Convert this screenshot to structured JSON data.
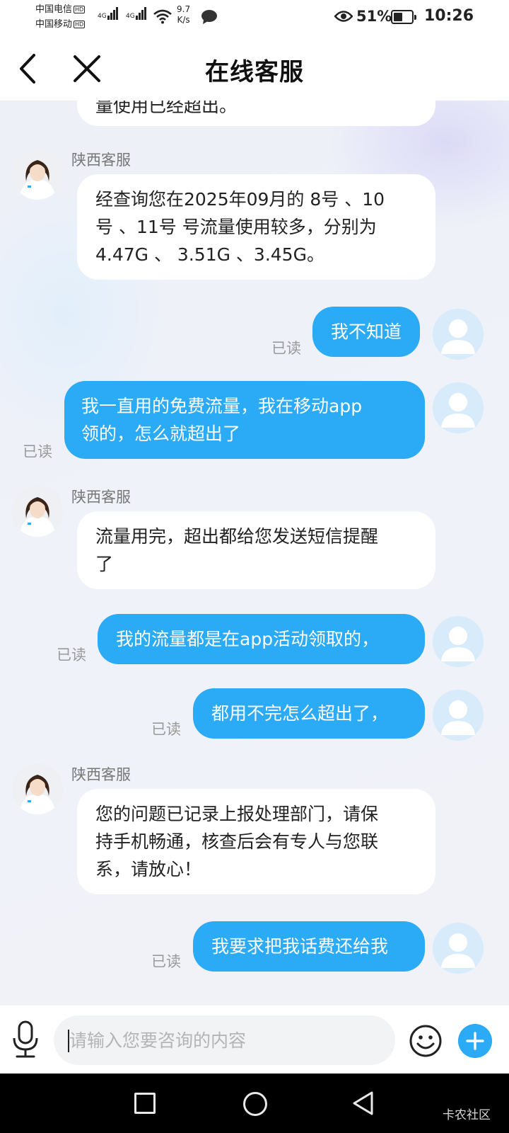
{
  "status_bar": {
    "carrier1": "中国电信",
    "carrier2": "中国移动",
    "hd_badge": "HD",
    "net_type1": "4G",
    "net_type2": "4G",
    "net_speed_value": "9.7",
    "net_speed_unit": "K/s",
    "battery_percent": "51%",
    "battery_level": 0.51,
    "time": "10:26",
    "icons": [
      "signal-icon",
      "wifi-icon",
      "message-icon",
      "eye-icon",
      "battery-icon"
    ]
  },
  "header": {
    "back_icon": "chevron-left-icon",
    "close_icon": "close-icon",
    "title": "在线客服"
  },
  "messages": [
    {
      "role": "agent",
      "partial": true,
      "lines": [
        "量使用已经超出。"
      ]
    },
    {
      "role": "agent",
      "sender": "陕西客服",
      "lines": [
        "经查询您在2025年09月的 8号 、10",
        "号 、11号 号流量使用较多，分别为",
        "4.47G 、 3.51G 、3.45G。"
      ]
    },
    {
      "role": "user",
      "status": "已读",
      "lines": [
        "我不知道"
      ]
    },
    {
      "role": "user",
      "status": "已读",
      "lines": [
        "我一直用的免费流量，我在移动app",
        "领的，怎么就超出了"
      ]
    },
    {
      "role": "agent",
      "sender": "陕西客服",
      "lines": [
        "流量用完，超出都给您发送短信提醒",
        "了"
      ]
    },
    {
      "role": "user",
      "status": "已读",
      "lines": [
        "我的流量都是在app活动领取的，"
      ]
    },
    {
      "role": "user",
      "status": "已读",
      "lines": [
        "都用不完怎么超出了，"
      ]
    },
    {
      "role": "agent",
      "sender": "陕西客服",
      "lines": [
        "您的问题已记录上报处理部门，请保",
        "持手机畅通，核查后会有专人与您联",
        "系，请放心！"
      ]
    },
    {
      "role": "user",
      "status": "已读",
      "lines": [
        "我要求把我话费还给我"
      ]
    }
  ],
  "input_bar": {
    "placeholder": "请输入您要咨询的内容",
    "value": "",
    "mic_icon": "microphone-icon",
    "emoji_icon": "emoji-icon",
    "plus_icon": "plus-icon",
    "accent_color": "#2baaf6"
  },
  "nav_bar": {
    "icons": [
      "recent-apps-icon",
      "home-icon",
      "back-triangle-icon"
    ],
    "watermark": "卡农社区"
  }
}
